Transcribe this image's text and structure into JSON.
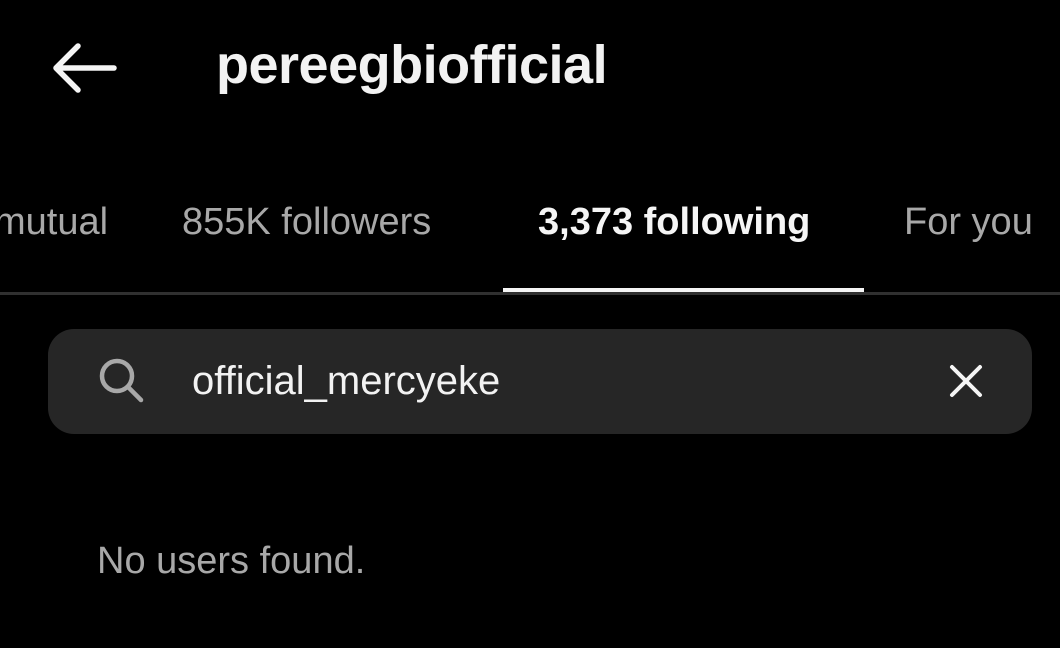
{
  "header": {
    "back_icon": "arrow-left-icon",
    "title": "pereegbiofficial"
  },
  "tabs": [
    {
      "label": "mutual",
      "active": false
    },
    {
      "label": "855K followers",
      "active": false
    },
    {
      "label": "3,373 following",
      "active": true
    },
    {
      "label": "For you",
      "active": false
    }
  ],
  "search": {
    "icon": "search-icon",
    "value": "official_mercyeke",
    "clear_icon": "close-icon"
  },
  "empty_state": {
    "message": "No users found."
  },
  "colors": {
    "background": "#000000",
    "search_bg": "#262626",
    "text_primary": "#f5f5f5",
    "text_secondary": "#a8a8a8",
    "divider": "#303030"
  }
}
